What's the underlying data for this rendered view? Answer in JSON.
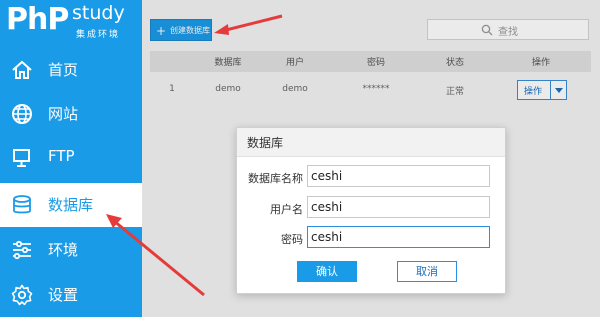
{
  "logo": {
    "brand": "PhP",
    "product": "study",
    "subtitle": "集成环境"
  },
  "sidebar": {
    "items": [
      {
        "label": "首页",
        "icon": "home-icon"
      },
      {
        "label": "网站",
        "icon": "globe-icon"
      },
      {
        "label": "FTP",
        "icon": "server-icon"
      },
      {
        "label": "数据库",
        "icon": "database-icon",
        "active": true
      },
      {
        "label": "环境",
        "icon": "sliders-icon"
      },
      {
        "label": "设置",
        "icon": "gear-icon"
      }
    ]
  },
  "toolbar": {
    "create_label": "创建数据库",
    "search_placeholder": "查找"
  },
  "table": {
    "columns": [
      "数据库",
      "用户",
      "密码",
      "状态",
      "操作"
    ],
    "rows": [
      {
        "index": "1",
        "database": "demo",
        "user": "demo",
        "password": "******",
        "status": "正常",
        "action": "操作"
      }
    ]
  },
  "dialog": {
    "title": "数据库",
    "fields": [
      {
        "label": "数据库名称",
        "value": "ceshi"
      },
      {
        "label": "用户名",
        "value": "ceshi"
      },
      {
        "label": "密码",
        "value": "ceshi"
      }
    ],
    "ok_label": "确认",
    "cancel_label": "取消"
  },
  "colors": {
    "accent": "#1a9be8",
    "annotation": "#e53b3b"
  }
}
